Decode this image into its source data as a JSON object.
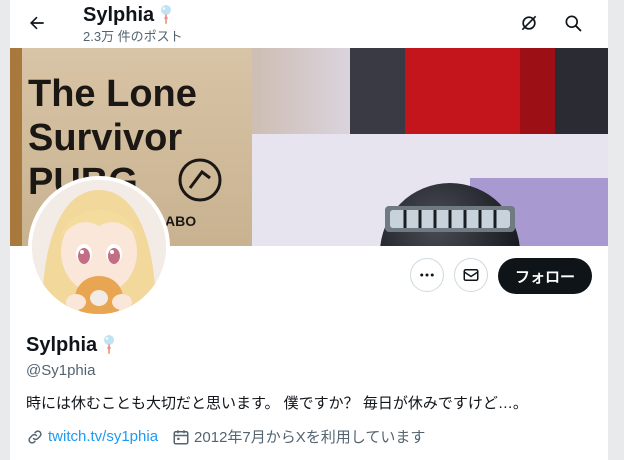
{
  "header": {
    "title": "Sylphia",
    "post_count": "2.3万 件のポスト"
  },
  "banner": {
    "book_line1": "The Lone",
    "book_line2": "Survivor",
    "book_line3": "PUBG",
    "book_credit": "ABO"
  },
  "actions": {
    "follow_label": "フォロー"
  },
  "profile": {
    "name": "Sylphia",
    "handle": "@Sy1phia",
    "bio": "時には休むことも大切だと思います。 僕ですか？ 毎日が休みですけど…。",
    "link": "twitch.tv/sy1phia",
    "joined": "2012年7月からXを利用しています"
  },
  "icons": [
    "back-arrow-icon",
    "no-notification-icon",
    "search-icon",
    "more-icon",
    "message-icon",
    "link-icon",
    "calendar-icon",
    "ice-cream-emoji-icon"
  ],
  "colors": {
    "accent": "#1d9bf0",
    "text": "#0f1419",
    "muted": "#536471",
    "follow_bg": "#0f1419"
  }
}
